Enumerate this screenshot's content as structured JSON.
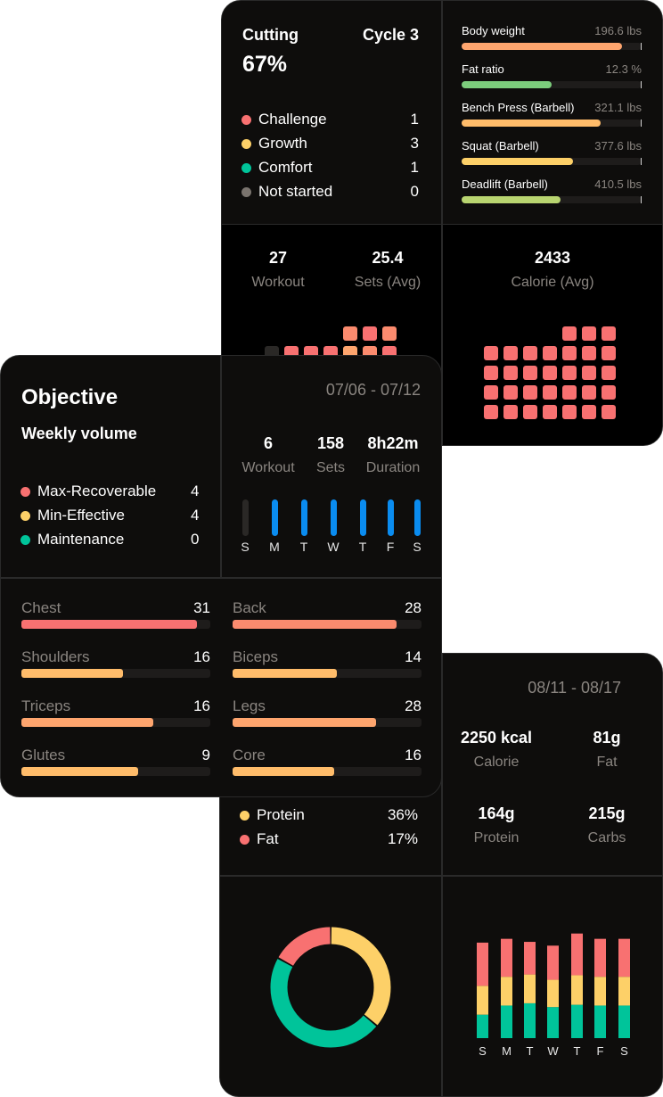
{
  "colors": {
    "challenge": "#f87171",
    "growth": "#fdd068",
    "comfort": "#00c49a",
    "not_started": "#7a746e",
    "blue": "#0a8cf0",
    "inactive": "#2a2826",
    "salmon": "#fb8b6e",
    "orange": "#fea56e",
    "light_orange": "#ffbc6a",
    "green": "#7ccd7c",
    "olive": "#b8d470"
  },
  "cycle_card": {
    "phase": "Cutting",
    "cycle": "Cycle 3",
    "progress_label": "67%",
    "progress_percent": 67,
    "legend": [
      {
        "label": "Challenge",
        "value": "1",
        "color_key": "challenge"
      },
      {
        "label": "Growth",
        "value": "3",
        "color_key": "growth"
      },
      {
        "label": "Comfort",
        "value": "1",
        "color_key": "comfort"
      },
      {
        "label": "Not started",
        "value": "0",
        "color_key": "not_started"
      }
    ],
    "metrics": [
      {
        "label": "Body weight",
        "value": "196.6 lbs",
        "fraction": 0.89,
        "color": "#fea56e"
      },
      {
        "label": "Fat ratio",
        "value": "12.3 %",
        "fraction": 0.5,
        "color": "#7ccd7c"
      },
      {
        "label": "Bench Press (Barbell)",
        "value": "321.1 lbs",
        "fraction": 0.77,
        "color": "#ffbc6a"
      },
      {
        "label": "Squat (Barbell)",
        "value": "377.6 lbs",
        "fraction": 0.62,
        "color": "#fdd068"
      },
      {
        "label": "Deadlift (Barbell)",
        "value": "410.5 lbs",
        "fraction": 0.55,
        "color": "#b8d470"
      }
    ],
    "workout_stats": [
      {
        "value": "27",
        "label": "Workout"
      },
      {
        "value": "25.4",
        "label": "Sets (Avg)"
      }
    ],
    "workout_grid_top_row": [
      "inactive",
      "challenge",
      "challenge",
      "challenge",
      "orange",
      "salmon",
      "challenge"
    ],
    "workout_grid_extra_row": [
      "salmon",
      "challenge",
      "salmon"
    ],
    "calorie_stat": {
      "value": "2433",
      "label": "Calorie (Avg)"
    }
  },
  "objective_card": {
    "title": "Objective",
    "subtitle": "Weekly volume",
    "date_range": "07/06 - 07/12",
    "legend": [
      {
        "label": "Max-Recoverable",
        "value": "4",
        "color_key": "challenge"
      },
      {
        "label": "Min-Effective",
        "value": "4",
        "color_key": "growth"
      },
      {
        "label": "Maintenance",
        "value": "0",
        "color_key": "comfort"
      }
    ],
    "stats": [
      {
        "value": "6",
        "label": "Workout"
      },
      {
        "value": "158",
        "label": "Sets"
      },
      {
        "value": "8h22m",
        "label": "Duration"
      }
    ],
    "days": [
      {
        "label": "S",
        "active": false
      },
      {
        "label": "M",
        "active": true
      },
      {
        "label": "T",
        "active": true
      },
      {
        "label": "W",
        "active": true
      },
      {
        "label": "T",
        "active": true
      },
      {
        "label": "F",
        "active": true
      },
      {
        "label": "S",
        "active": true
      }
    ],
    "muscles": [
      {
        "name": "Chest",
        "value": "31",
        "fraction": 0.93,
        "color": "#f87171"
      },
      {
        "name": "Back",
        "value": "28",
        "fraction": 0.87,
        "color": "#fb8b6e"
      },
      {
        "name": "Shoulders",
        "value": "16",
        "fraction": 0.54,
        "color": "#ffbc6a"
      },
      {
        "name": "Biceps",
        "value": "14",
        "fraction": 0.55,
        "color": "#ffbc6a"
      },
      {
        "name": "Triceps",
        "value": "16",
        "fraction": 0.7,
        "color": "#fea56e"
      },
      {
        "name": "Legs",
        "value": "28",
        "fraction": 0.76,
        "color": "#fea56e"
      },
      {
        "name": "Glutes",
        "value": "9",
        "fraction": 0.62,
        "color": "#ffbc6a"
      },
      {
        "name": "Core",
        "value": "16",
        "fraction": 0.54,
        "color": "#ffbc6a"
      }
    ]
  },
  "nutrition_card": {
    "date_range": "08/11 - 08/17",
    "legend": [
      {
        "label": "Protein",
        "value": "36%",
        "color_key": "growth"
      },
      {
        "label": "Fat",
        "value": "17%",
        "color_key": "challenge"
      }
    ],
    "stats": [
      {
        "value": "2250 kcal",
        "label": "Calorie"
      },
      {
        "value": "81g",
        "label": "Fat"
      },
      {
        "value": "164g",
        "label": "Protein"
      },
      {
        "value": "215g",
        "label": "Carbs"
      }
    ],
    "donut": [
      {
        "name": "Protein",
        "percent": 36,
        "color_key": "growth"
      },
      {
        "name": "Carbs",
        "percent": 47,
        "color_key": "comfort"
      },
      {
        "name": "Fat",
        "percent": 17,
        "color_key": "challenge"
      }
    ],
    "weekly": [
      {
        "day": "S",
        "carbs": 31,
        "protein": 38,
        "fat": 57
      },
      {
        "day": "M",
        "carbs": 43,
        "protein": 38,
        "fat": 50
      },
      {
        "day": "T",
        "carbs": 46,
        "protein": 38,
        "fat": 43
      },
      {
        "day": "W",
        "carbs": 41,
        "protein": 36,
        "fat": 45
      },
      {
        "day": "T",
        "carbs": 44,
        "protein": 39,
        "fat": 55
      },
      {
        "day": "F",
        "carbs": 43,
        "protein": 38,
        "fat": 50
      },
      {
        "day": "S",
        "carbs": 43,
        "protein": 38,
        "fat": 50
      }
    ]
  }
}
